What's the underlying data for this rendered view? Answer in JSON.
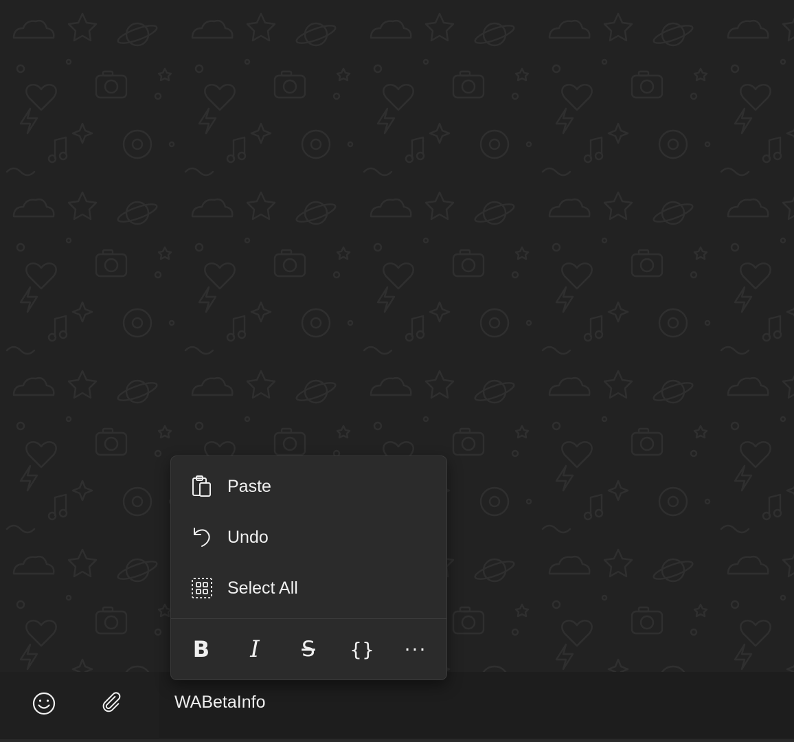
{
  "watermark": "WABETAINFO",
  "context_menu": {
    "items": [
      {
        "label": "Paste",
        "icon": "paste-icon"
      },
      {
        "label": "Undo",
        "icon": "undo-icon"
      },
      {
        "label": "Select All",
        "icon": "select-all-icon"
      }
    ],
    "format_bar": {
      "bold": "B",
      "italic": "I",
      "strikethrough": "S",
      "monospace": "{}",
      "more": "···"
    }
  },
  "composer": {
    "emoji_icon": "emoji-icon",
    "attach_icon": "paperclip-icon",
    "text": "WABetaInfo"
  },
  "colors": {
    "background": "#222222",
    "menu": "#2b2b2b",
    "text": "#f0f0f0"
  }
}
